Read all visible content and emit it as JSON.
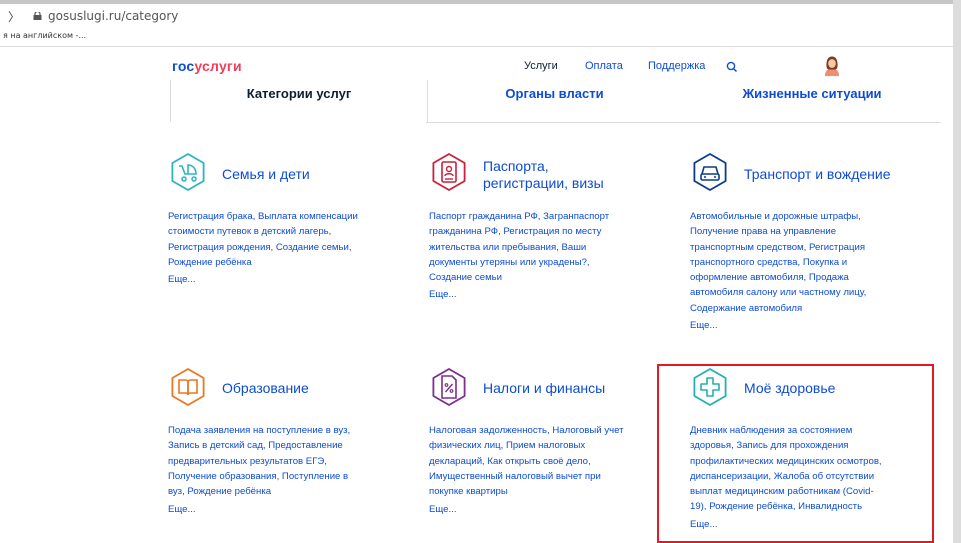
{
  "browser": {
    "url": "gosuslugi.ru/category",
    "bookmark_text": "я на английском -..."
  },
  "header": {
    "logo_part1": "гос",
    "logo_part2": "услуги",
    "nav": [
      "Услуги",
      "Оплата",
      "Поддержка"
    ],
    "search_icon": "search-icon",
    "avatar_icon": "user-avatar-icon"
  },
  "tabs": [
    "Категории услуг",
    "Органы власти",
    "Жизненные ситуации"
  ],
  "categories": [
    {
      "title": "Семья и дети",
      "icon": "stroller-icon",
      "links": "Регистрация брака, Выплата компенсации\nстоимости путевок в детский лагерь,\nРегистрация рождения, Создание семьи,\nРождение ребёнка",
      "more": "Еще..."
    },
    {
      "title": "Паспорта,\nрегистрации, визы",
      "icon": "passport-icon",
      "links": "Паспорт гражданина РФ, Загранпаспорт\nгражданина РФ, Регистрация по месту\nжительства или пребывания, Ваши\nдокументы утеряны или украдены?,\nСоздание семьи",
      "more": "Еще..."
    },
    {
      "title": "Транспорт и вождение",
      "icon": "car-icon",
      "links": "Автомобильные и дорожные штрафы,\nПолучение права на управление\nтранспортным средством, Регистрация\nтранспортного средства, Покупка и\nоформление автомобиля, Продажа\nавтомобиля салону или частному лицу,\nСодержание автомобиля",
      "more": "Еще..."
    },
    {
      "title": "Образование",
      "icon": "book-icon",
      "links": "Подача заявления на поступление в вуз,\nЗапись в детский сад, Предоставление\nпредварительных результатов ЕГЭ,\nПолучение образования, Поступление в\nвуз, Рождение ребёнка",
      "more": "Еще..."
    },
    {
      "title": "Налоги и финансы",
      "icon": "tax-document-icon",
      "links": "Налоговая задолженность, Налоговый учет\nфизических лиц, Прием налоговых\nдеклараций, Как открыть своё дело,\nИмущественный налоговый вычет при\nпокупке квартиры",
      "more": "Еще..."
    },
    {
      "title": "Моё здоровье",
      "icon": "medical-cross-icon",
      "links": "Дневник наблюдения за состоянием\nздоровья, Запись для прохождения\nпрофилактических медицинских осмотров,\nдиспансеризации, Жалоба об отсутствии\nвыплат медицинским работникам (Covid-\n19), Рождение ребёнка, Инвалидность",
      "more": "Еще..."
    }
  ],
  "colors": {
    "link_blue": "#0d4cd3",
    "logo_red": "#ee3f58",
    "highlight_red": "#e01b24",
    "icon_teal": "#2bb5c3",
    "icon_crimson": "#c9213d",
    "icon_darkblue": "#0b3c8c",
    "icon_orange": "#e87722",
    "icon_purple": "#7d2e8e",
    "icon_green": "#24b0ae"
  }
}
